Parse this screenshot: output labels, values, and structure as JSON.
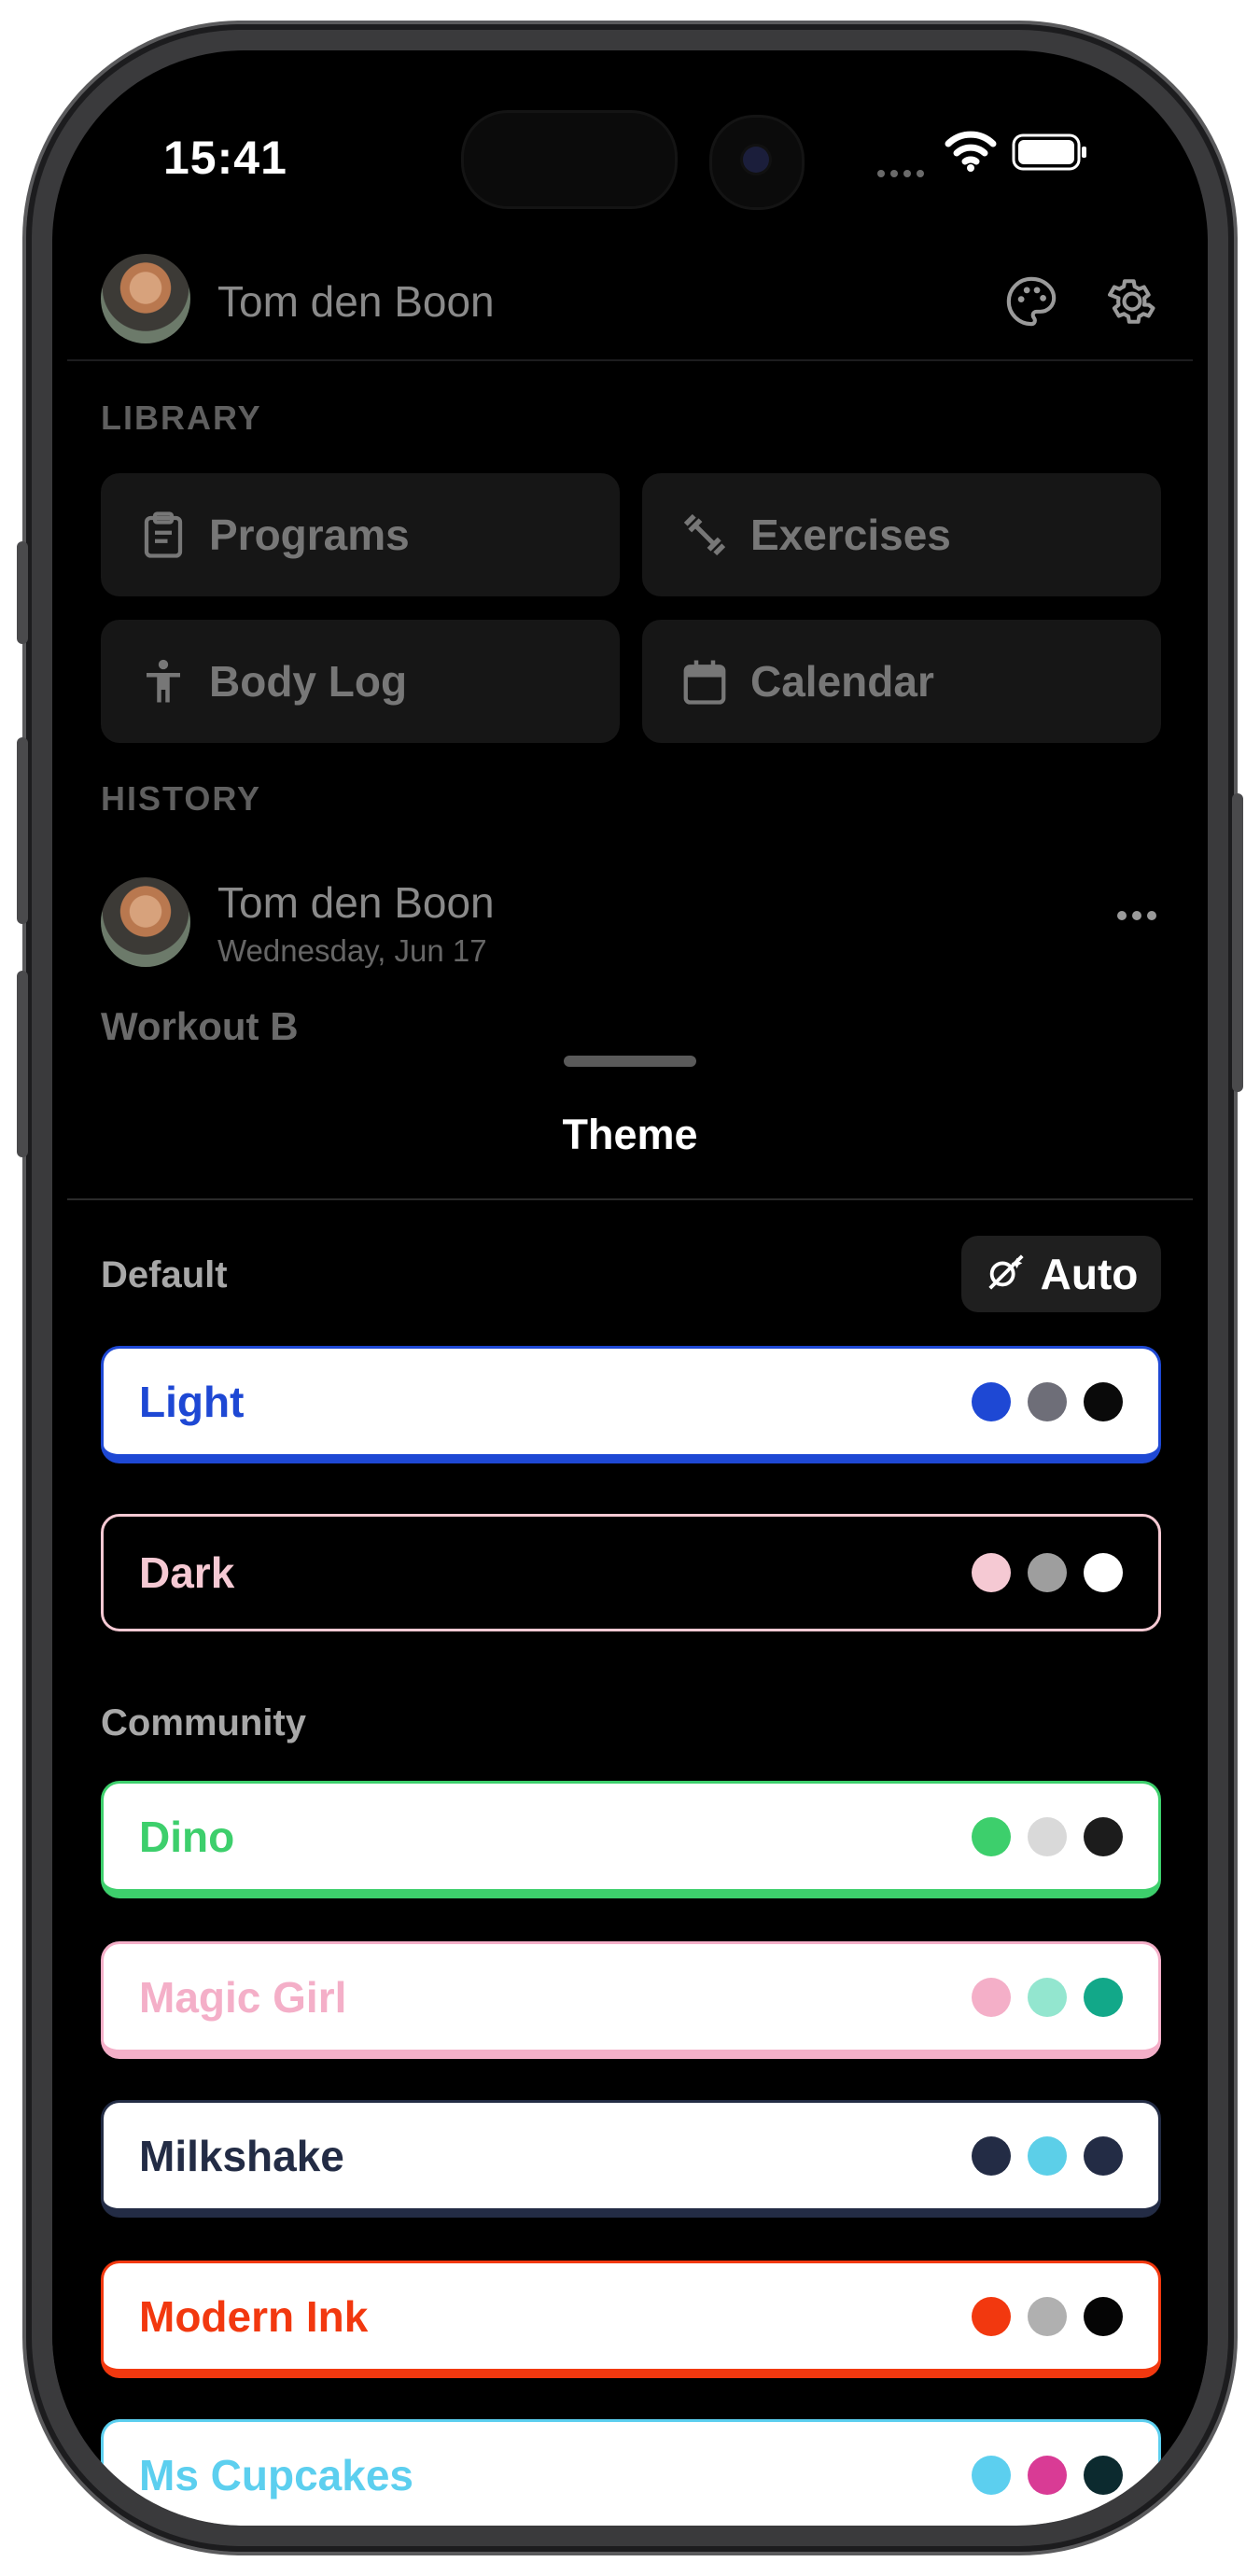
{
  "status_bar": {
    "time": "15:41"
  },
  "header": {
    "user_name": "Tom den Boon",
    "palette_icon": "palette-icon",
    "settings_icon": "gear-icon"
  },
  "library": {
    "title": "LIBRARY",
    "tiles": [
      {
        "label": "Programs",
        "icon": "clipboard-icon"
      },
      {
        "label": "Exercises",
        "icon": "dumbbell-icon"
      },
      {
        "label": "Body Log",
        "icon": "person-icon"
      },
      {
        "label": "Calendar",
        "icon": "calendar-icon"
      }
    ]
  },
  "history": {
    "title": "HISTORY",
    "entry": {
      "user_name": "Tom den Boon",
      "date": "Wednesday, Jun 17",
      "workout": "Workout B"
    }
  },
  "sheet": {
    "title": "Theme",
    "default_label": "Default",
    "auto_label": "Auto",
    "community_label": "Community",
    "default_themes": [
      {
        "name": "Light",
        "style": "light",
        "accent": "#1e48d4",
        "dots": [
          "#1e48d4",
          "#6e6e78",
          "#0a0a0a"
        ]
      },
      {
        "name": "Dark",
        "style": "dark",
        "accent": "#f5c9d3",
        "dots": [
          "#f5c9d3",
          "#9e9e9e",
          "#ffffff"
        ]
      }
    ],
    "community_themes": [
      {
        "name": "Dino",
        "accent": "#3dcf6c",
        "dots": [
          "#3dcf6c",
          "#d9d9d9",
          "#1c1c1c"
        ]
      },
      {
        "name": "Magic Girl",
        "accent": "#f4afc8",
        "dots": [
          "#f4afc8",
          "#93e6cf",
          "#12a889"
        ]
      },
      {
        "name": "Milkshake",
        "accent": "#232c45",
        "dots": [
          "#232c45",
          "#5ccfe8",
          "#232c45"
        ]
      },
      {
        "name": "Modern Ink",
        "accent": "#f2380f",
        "dots": [
          "#f2380f",
          "#b0b0b0",
          "#050505"
        ]
      },
      {
        "name": "Ms Cupcakes",
        "accent": "#5ccfef",
        "dots": [
          "#5ccfef",
          "#d93b95",
          "#0c2a2f"
        ]
      }
    ]
  }
}
